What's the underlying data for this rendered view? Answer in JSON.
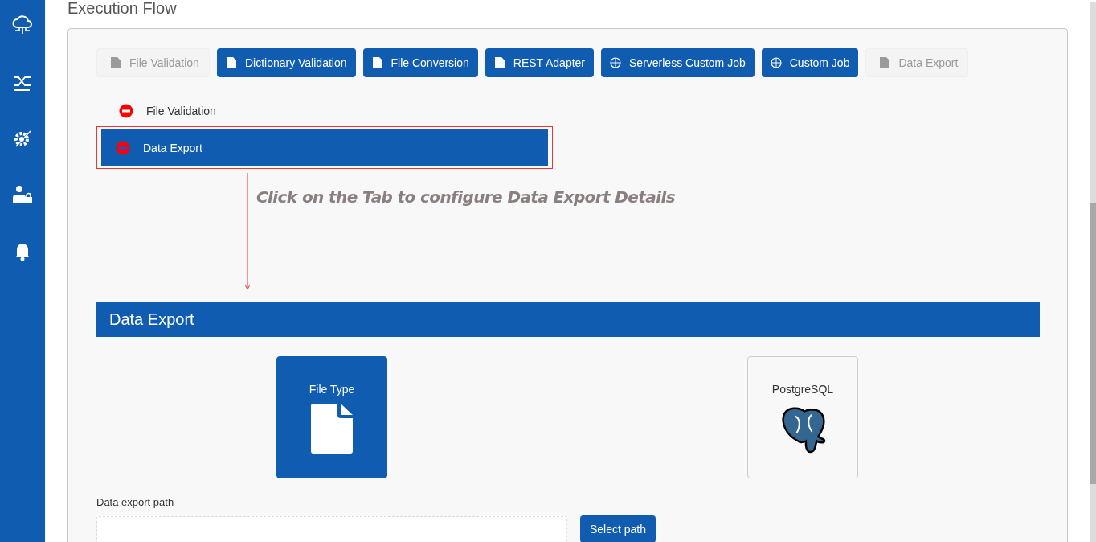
{
  "page_title": "Execution Flow",
  "flow_buttons": [
    {
      "label": "File Validation",
      "disabled": true
    },
    {
      "label": "Dictionary Validation",
      "disabled": false
    },
    {
      "label": "File Conversion",
      "disabled": false
    },
    {
      "label": "REST Adapter",
      "disabled": false
    },
    {
      "label": "Serverless Custom Job",
      "disabled": false
    },
    {
      "label": "Custom Job",
      "disabled": false
    },
    {
      "label": "Data Export",
      "disabled": true
    }
  ],
  "steps": [
    {
      "label": "File Validation",
      "selected": false
    },
    {
      "label": "Data Export",
      "selected": true
    }
  ],
  "hint": "Click on the Tab to configure Data Export Details",
  "section_title": "Data Export",
  "export_types": [
    {
      "label": "File Type",
      "kind": "file",
      "selected": true
    },
    {
      "label": "PostgreSQL",
      "kind": "postgres",
      "selected": false
    }
  ],
  "path_field": {
    "label": "Data export path",
    "button": "Select path"
  }
}
